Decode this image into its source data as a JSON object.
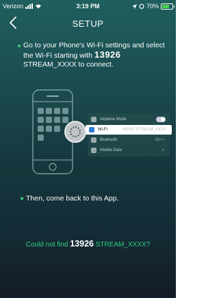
{
  "status_bar": {
    "carrier": "Verizon",
    "time": "3:19 PM",
    "battery": "70%",
    "battery_level": 0.7,
    "accent": "#45d14f"
  },
  "nav": {
    "title": "SETUP",
    "back_icon": "chevron-left-icon"
  },
  "instruction": {
    "pre": "Go to your Phone's Wi-Fi settings and select the Wi-Fi starting with ",
    "number": "13926",
    "post": " STREAM_XXXX to connect."
  },
  "illustration": {
    "rows": [
      {
        "label": "Airplane Mode",
        "value": ""
      },
      {
        "label": "Wi-Fi",
        "value": "NERO STREAM_XXXX"
      },
      {
        "label": "Bluetooth",
        "value": "On >"
      },
      {
        "label": "Mobile Data",
        "value": ">"
      }
    ]
  },
  "then_text": "Then, come back to this App.",
  "not_found": {
    "pre": "Could not find ",
    "number": "13926",
    "post": " STREAM_XXXX?"
  },
  "colors": {
    "accent_green": "#2ecf82"
  }
}
